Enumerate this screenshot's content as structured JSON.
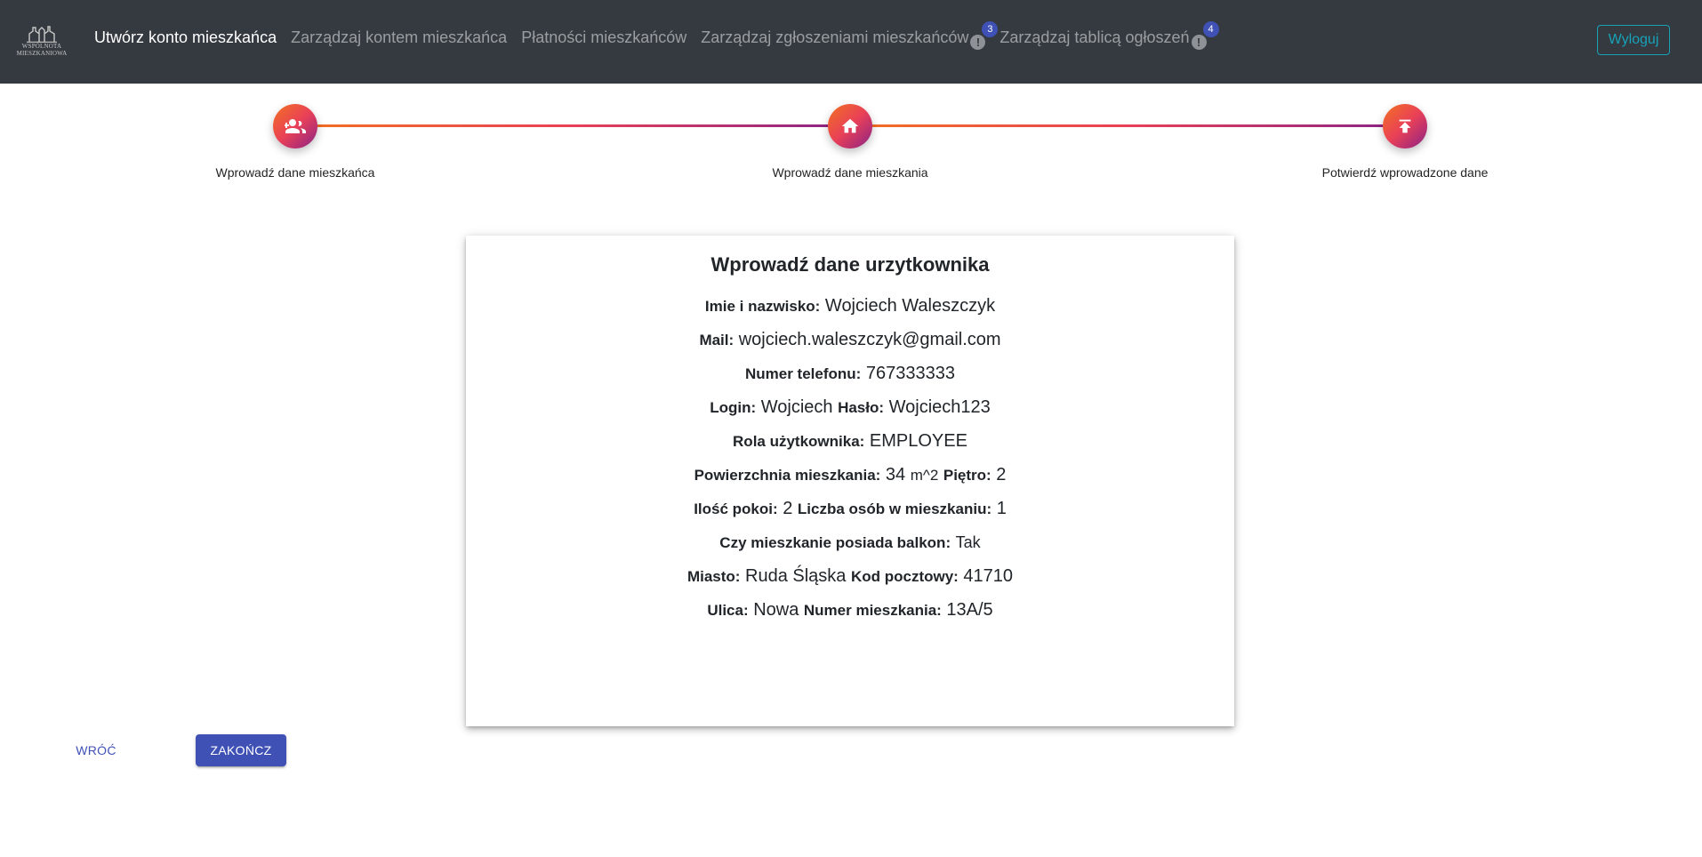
{
  "navbar": {
    "logo_line1": "WSPÓLNOTA",
    "logo_line2": "MIESZKANIOWA",
    "items": [
      {
        "label": "Utwórz konto mieszkańca"
      },
      {
        "label": "Zarządzaj kontem mieszkańca"
      },
      {
        "label": "Płatności mieszkańców"
      },
      {
        "label": "Zarządzaj zgłoszeniami mieszkańców",
        "badge": "3",
        "warning": "!"
      },
      {
        "label": "Zarządzaj tablicą ogłoszeń",
        "badge": "4",
        "warning": "!"
      }
    ],
    "logout_label": "Wyloguj"
  },
  "stepper": {
    "steps": [
      {
        "label": "Wprowadź dane mieszkańca",
        "icon": "add-user-icon"
      },
      {
        "label": "Wprowadź dane mieszkania",
        "icon": "home-icon"
      },
      {
        "label": "Potwierdź wprowadzone dane",
        "icon": "upload-icon"
      }
    ]
  },
  "card": {
    "title": "Wprowadź dane urzytkownika",
    "fullname_label": "Imie i nazwisko:",
    "fullname": "Wojciech Waleszczyk",
    "mail_label": "Mail:",
    "mail": "wojciech.waleszczyk@gmail.com",
    "phone_label": "Numer telefonu:",
    "phone": "767333333",
    "login_label": "Login:",
    "login": "Wojciech",
    "password_label": "Hasło:",
    "password": "Wojciech123",
    "role_label": "Rola użytkownika:",
    "role": "EMPLOYEE",
    "area_label": "Powierzchnia mieszkania:",
    "area": "34",
    "area_unit": "m^2",
    "floor_label": "Piętro:",
    "floor": "2",
    "rooms_label": "Ilość pokoi:",
    "rooms": "2",
    "people_label": "Liczba osób w mieszkaniu:",
    "people": "1",
    "balcony_label": "Czy mieszkanie posiada balkon:",
    "balcony": "Tak",
    "city_label": "Miasto:",
    "city": "Ruda Śląska",
    "postal_label": "Kod pocztowy:",
    "postal": "41710",
    "street_label": "Ulica:",
    "street": "Nowa",
    "flat_label": "Numer mieszkania:",
    "flat": "13A/5"
  },
  "actions": {
    "back_label": "WRÓĆ",
    "finish_label": "ZAKOŃCZ"
  },
  "colors": {
    "navbar": "#343a40",
    "primary": "#3f51b5",
    "logout_outline": "#17a2b8",
    "gradient_start": "#f27121",
    "gradient_mid": "#e94057",
    "gradient_end": "#8a2387"
  }
}
